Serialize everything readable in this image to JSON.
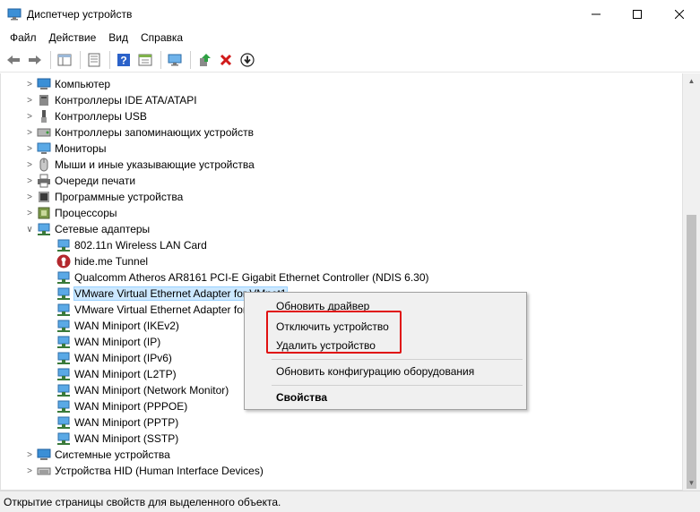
{
  "window": {
    "title": "Диспетчер устройств",
    "minimize_symbol": "—",
    "maximize_symbol": "☐",
    "close_symbol": "✕"
  },
  "menu": [
    "Файл",
    "Действие",
    "Вид",
    "Справка"
  ],
  "tree": {
    "categories_top": [
      {
        "label": "Компьютер",
        "icon": "computer-icon"
      },
      {
        "label": "Контроллеры IDE ATA/ATAPI",
        "icon": "ide-controller-icon"
      },
      {
        "label": "Контроллеры USB",
        "icon": "usb-icon"
      },
      {
        "label": "Контроллеры запоминающих устройств",
        "icon": "storage-controller-icon"
      },
      {
        "label": "Мониторы",
        "icon": "monitor-icon"
      },
      {
        "label": "Мыши и иные указывающие устройства",
        "icon": "mouse-icon"
      },
      {
        "label": "Очереди печати",
        "icon": "printer-icon"
      },
      {
        "label": "Программные устройства",
        "icon": "software-device-icon"
      },
      {
        "label": "Процессоры",
        "icon": "processor-icon"
      }
    ],
    "network_category": {
      "label": "Сетевые адаптеры",
      "icon": "network-adapter-icon"
    },
    "network_children": [
      {
        "label": "802.11n Wireless LAN Card",
        "icon": "network-adapter-icon"
      },
      {
        "label": "hide.me Tunnel",
        "icon": "hideme-icon"
      },
      {
        "label": "Qualcomm Atheros AR8161 PCI-E Gigabit Ethernet Controller (NDIS 6.30)",
        "icon": "network-adapter-icon"
      },
      {
        "label": "VMware Virtual Ethernet Adapter for VMnet1",
        "icon": "network-adapter-icon",
        "selected": true
      },
      {
        "label": "VMware Virtual Ethernet Adapter for VMnet8",
        "icon": "network-adapter-icon"
      },
      {
        "label": "WAN Miniport (IKEv2)",
        "icon": "network-adapter-icon"
      },
      {
        "label": "WAN Miniport (IP)",
        "icon": "network-adapter-icon"
      },
      {
        "label": "WAN Miniport (IPv6)",
        "icon": "network-adapter-icon"
      },
      {
        "label": "WAN Miniport (L2TP)",
        "icon": "network-adapter-icon"
      },
      {
        "label": "WAN Miniport (Network Monitor)",
        "icon": "network-adapter-icon"
      },
      {
        "label": "WAN Miniport (PPPOE)",
        "icon": "network-adapter-icon"
      },
      {
        "label": "WAN Miniport (PPTP)",
        "icon": "network-adapter-icon"
      },
      {
        "label": "WAN Miniport (SSTP)",
        "icon": "network-adapter-icon"
      }
    ],
    "categories_bottom": [
      {
        "label": "Системные устройства",
        "icon": "system-device-icon"
      },
      {
        "label": "Устройства HID (Human Interface Devices)",
        "icon": "hid-icon"
      }
    ]
  },
  "context_menu": {
    "update_driver": "Обновить драйвер",
    "disable_device": "Отключить устройство",
    "uninstall_device": "Удалить устройство",
    "scan_hardware": "Обновить конфигурацию оборудования",
    "properties": "Свойства"
  },
  "status": "Открытие страницы свойств для выделенного объекта.",
  "colors": {
    "selection": "#cce8ff",
    "highlight_box": "#e01010",
    "menu_bg": "#f0f0f0"
  }
}
